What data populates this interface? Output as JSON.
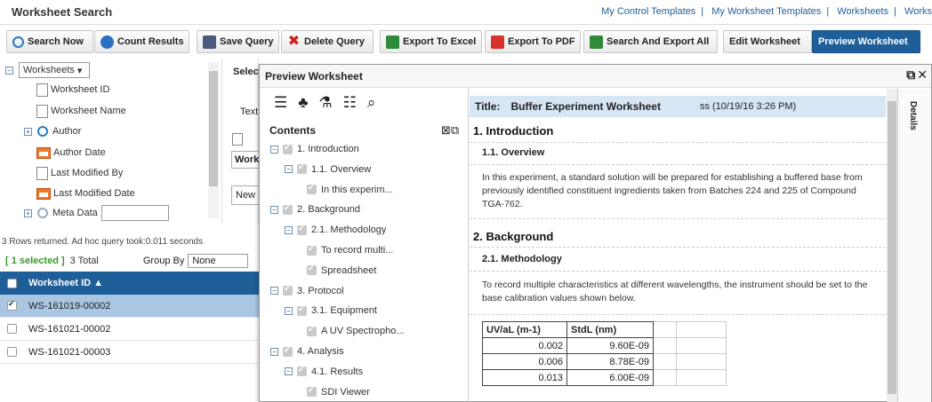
{
  "app": {
    "title": "Worksheet Search"
  },
  "top_links": [
    "My Control Templates",
    "My Worksheet Templates",
    "Worksheets",
    "Works"
  ],
  "toolbar": {
    "search_now": "Search Now",
    "count_results": "Count Results",
    "save_query": "Save Query",
    "delete_query": "Delete Query",
    "export_excel": "Export To Excel",
    "export_pdf": "Export To PDF",
    "search_export_all": "Search And Export All",
    "edit_worksheet": "Edit Worksheet",
    "preview_worksheet": "Preview Worksheet"
  },
  "field_tree": {
    "root": "Worksheets",
    "items": [
      "Worksheet ID",
      "Worksheet Name",
      "Author",
      "Author Date",
      "Last Modified By",
      "Last Modified Date",
      "Meta Data"
    ]
  },
  "middle_fragments": {
    "select": "Selec",
    "text": "Text",
    "work": "Work",
    "new": "New"
  },
  "results": {
    "info": "3 Rows returned. Ad hoc query took:0.011 seconds",
    "selected": "[ 1 selected ]",
    "total": "3 Total",
    "group_by_label": "Group By",
    "group_by_value": "None",
    "column": "Worksheet ID",
    "rows": [
      {
        "id": "WS-161019-00002",
        "selected": true
      },
      {
        "id": "WS-161021-00002",
        "selected": false
      },
      {
        "id": "WS-161021-00003",
        "selected": false
      }
    ]
  },
  "modal": {
    "title": "Preview Worksheet",
    "toc_heading": "Contents",
    "toc": [
      {
        "label": "1. Introduction",
        "level": 0
      },
      {
        "label": "1.1. Overview",
        "level": 1
      },
      {
        "label": "In this experim...",
        "level": 2
      },
      {
        "label": "2. Background",
        "level": 0
      },
      {
        "label": "2.1. Methodology",
        "level": 1
      },
      {
        "label": "To record multi...",
        "level": 2
      },
      {
        "label": "Spreadsheet",
        "level": 2
      },
      {
        "label": "3. Protocol",
        "level": 0
      },
      {
        "label": "3.1. Equipment",
        "level": 1
      },
      {
        "label": "A UV Spectropho...",
        "level": 2
      },
      {
        "label": "4. Analysis",
        "level": 0
      },
      {
        "label": "4.1. Results",
        "level": 1
      },
      {
        "label": "SDI Viewer",
        "level": 2
      }
    ],
    "doc": {
      "title_label": "Title:",
      "title_value": "Buffer Experiment Worksheet",
      "author_stamp": "ss (10/19/16 3:26 PM)",
      "s1": "1.  Introduction",
      "s1_1": "1.1.  Overview",
      "p1": "In this experiment, a standard solution will be prepared for establishing a buffered base from previously identified constituent ingredients taken from Batches 224 and 225 of Compound TGA-762.",
      "s2": "2.  Background",
      "s2_1": "2.1.  Methodology",
      "p2": "To record multiple characteristics at different wavelengths, the instrument should be set to the base calibration values shown below.",
      "table_headers": [
        "UV/aL (m-1)",
        "StdL (nm)"
      ],
      "table_rows": [
        [
          "0.002",
          "9.60E-09"
        ],
        [
          "0.006",
          "8.78E-09"
        ],
        [
          "0.013",
          "6.00E-09"
        ]
      ]
    },
    "details_label": "Details"
  }
}
